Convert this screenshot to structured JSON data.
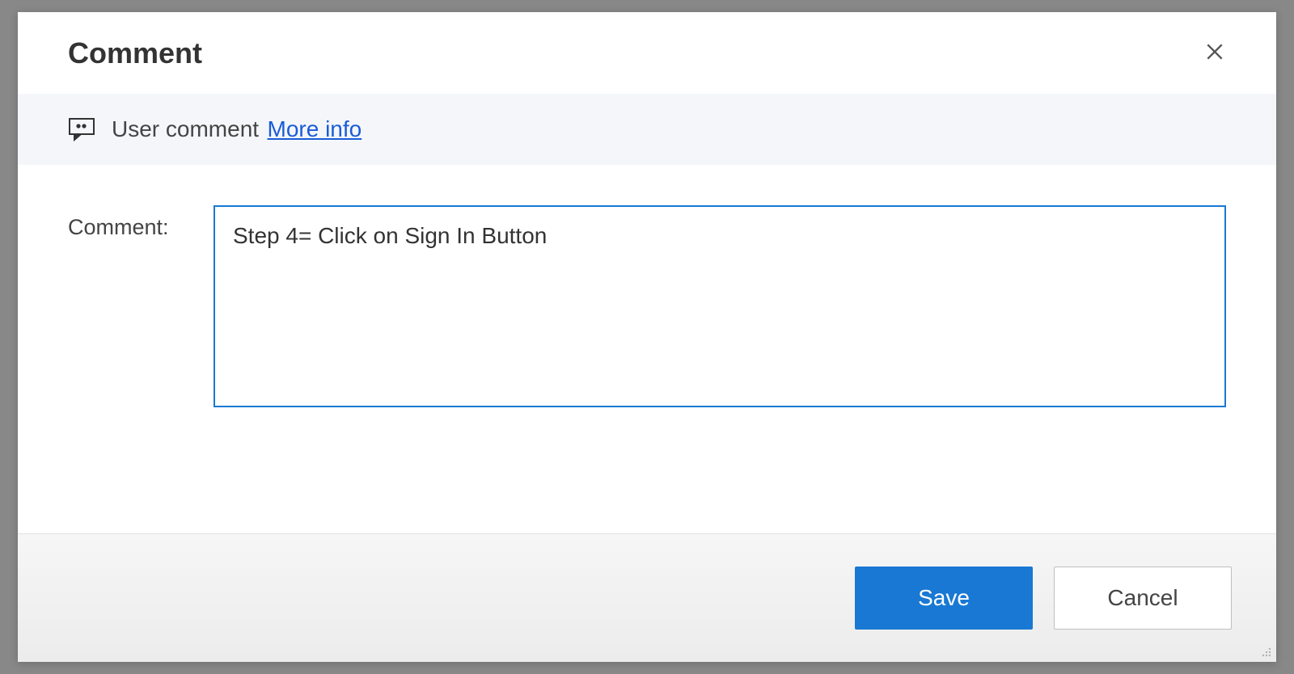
{
  "dialog": {
    "title": "Comment"
  },
  "info": {
    "label": "User comment",
    "link": "More info"
  },
  "form": {
    "comment_label": "Comment:",
    "comment_value": "Step 4= Click on Sign In Button"
  },
  "footer": {
    "save_label": "Save",
    "cancel_label": "Cancel"
  }
}
